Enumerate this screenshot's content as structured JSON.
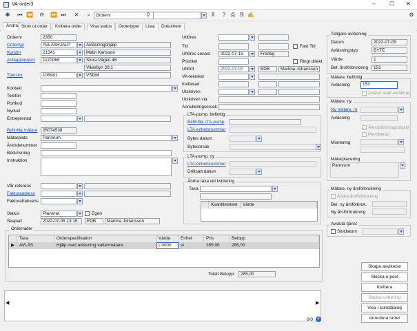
{
  "window": {
    "title": "VA-order3"
  },
  "toolbar": {
    "search_field": "Ordernr"
  },
  "tabs": [
    "Ändra",
    "Skriv ut order",
    "Kvittera order",
    "Visa status",
    "Ordertyper",
    "Lista",
    "Dokument"
  ],
  "left": {
    "ordernr_label": "Ordernr",
    "ordernr": "2350",
    "ordertyp_label": "Ordertyp",
    "ordertyp_code": "AVLÄSHJÄLP",
    "ordertyp_desc": "Avläsningshjälp",
    "kundnr_label": "Kundnr",
    "kundnr": "21341",
    "kund_name": "Malin Karlsson",
    "anl_label": "Anläggningsnr",
    "anl_nr": "1120066",
    "anl_addr1": "Stora Vägen 46",
    "anl_addr2": "Vikarbyn 30:1",
    "tjanst_label": "Tjänstnr",
    "tjanst_nr": "106981",
    "tjanst_desc": "VSDM",
    "kontakt_label": "Kontakt",
    "telefon_label": "Telefon",
    "portkod_label": "Portkod",
    "nyckel_label": "Nyckel",
    "entreprenad_label": "Entreprenad",
    "befintlig_matare_label": "Befintlig mätare",
    "befintlig_matare": "05074538",
    "matplats_label": "Mätarplats",
    "matplats": "Pannrum",
    "arendenummer_label": "Ärendenummer",
    "beskrivning_label": "Beskrivning",
    "instruktion_label": "Instruktion",
    "var_referens_label": "Vår referens",
    "fakturaadress_label": "Fakturaadress",
    "fakturafrekvens_label": "Fakturafrekvens",
    "status_label": "Status",
    "status": "Planerat",
    "egen_label": "Egen",
    "skapad_label": "Skapad",
    "skapad_datum": "2022-07-05 13:15",
    "skapad_av_code": "EDB",
    "skapad_av_name": "Martina Johansson"
  },
  "middle": {
    "utfores_label": "Utföres",
    "tid_label": "Tid",
    "fast_tid_label": "Fast Tid",
    "utfores_senast_label": "Utföres senast",
    "utfores_senast": "2022-07-15",
    "utfores_senast_day": "Fredag",
    "prioritet_label": "Prioritet",
    "ringt_direkt_label": "Ringt direkt",
    "utford_label": "Utförd",
    "utford": "2022-07-07",
    "utford_code": "EDB",
    "utford_name": "Martina Johansson",
    "va_tekniker_label": "VA-tekniker",
    "kvitterad_label": "Kvitterad",
    "utskriven_label": "Utskriven",
    "utskriven_via_label": "Utskriven via",
    "annulleringsorsak_label": "Annulleringsorsak",
    "lta_bef_title": "LTA-pump, befintlig",
    "lta_bef_pump_label": "Befintlig LTA-pump",
    "lta_bef_enhet_label": "LTA-enhetsnummer",
    "bytes_datum_label": "Bytes datum",
    "bytesorsak_label": "Bytesorsak",
    "lta_ny_title": "LTA-pump, ny",
    "lta_ny_enhet_label": "LTA-enhetsnummer",
    "driftsatt_label": "Driftsatt datum",
    "taxa_group_title": "Ändra taxa vid kvittering",
    "taxa_label": "Taxa",
    "taxa_cols": [
      "Kvantitetstext",
      "Värde"
    ]
  },
  "right": {
    "tidigare_title": "Tidigare avläsning",
    "datum_label": "Datum",
    "datum": "2022-07-05",
    "avlasningstyp_label": "Avläsningstyp",
    "avlasningstyp": "BYTE",
    "varde_label": "Värde",
    "varde": "1",
    "bef_arsforbrukning_label": "Bef. årsförbrukning",
    "bef_arsforbrukning": "151",
    "matare_bef_title": "Mätare, befintlig",
    "avlasning_label": "Avläsning",
    "avlasning": "153",
    "avlasn_skall_label": "Avläsn skall avräknas",
    "matare_ny_title": "Mätare, ny",
    "ny_matare_label": "Ny mätare, nr",
    "ny_avlasning_label": "Avläsning",
    "aterstromning_label": "Återströmningsskydd",
    "plomberad_label": "Plomberad",
    "montering_label": "Montering",
    "matplacering_label": "Mätarplacering",
    "matplacering": "Pannrum",
    "ny_ars_title": "Mätare, ny årsförbrukning",
    "andra_ars_label": "Ändra årsförbrukning",
    "ber_ny_ars_label": "Ber. ny årsförbruk.",
    "ny_ars_label": "Ny årsförbrukning",
    "avsluta_title": "Avsluta tjänst",
    "slutdatum_label": "Slutdatum"
  },
  "orderrader": {
    "title": "Orderrader",
    "columns": [
      "Taxa",
      "Orderspecifikation",
      "Värde",
      "Enhet",
      "Pris",
      "Belopp"
    ],
    "row": {
      "taxa": "AVLÄS",
      "spec": "Hjälp med avläsning vattenmätare",
      "varde": "1,0000",
      "enhet": "st",
      "pris": "285,00",
      "belopp": "285,00"
    },
    "totalt_label": "Totalt Belopp:",
    "totalt": "285,00"
  },
  "buttons": {
    "skapa_avvikelse": "Skapa avvikelse",
    "skicka_epost": "Skicka e-post",
    "kvittera": "Kvittera",
    "backa_kvittering": "Backa kvittering",
    "visa_kunddialog": "Visa i kunddialog",
    "annullera_order": "Annullera order"
  },
  "bottom": {
    "count": "0/0"
  }
}
